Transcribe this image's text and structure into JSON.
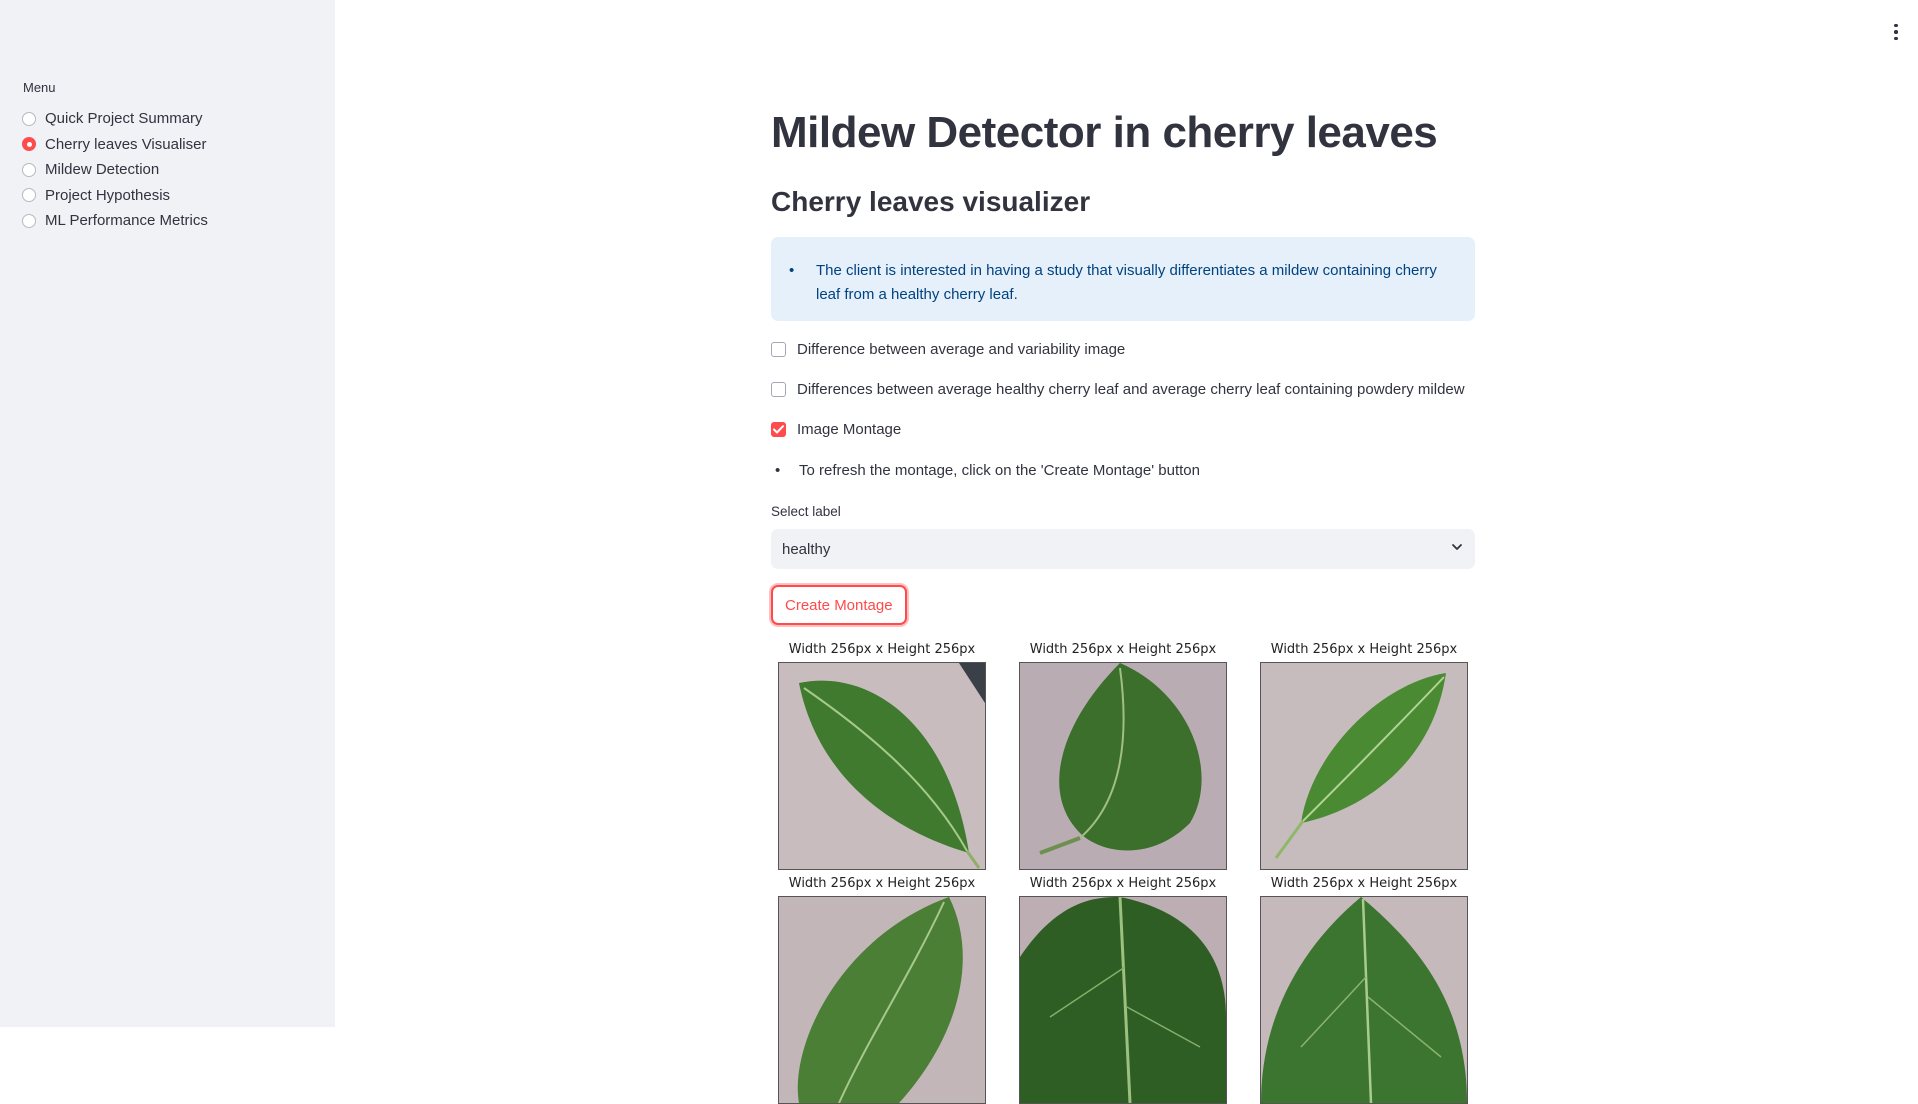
{
  "sidebar": {
    "menu_label": "Menu",
    "items": [
      {
        "label": "Quick Project Summary",
        "selected": false
      },
      {
        "label": "Cherry leaves Visualiser",
        "selected": true
      },
      {
        "label": "Mildew Detection",
        "selected": false
      },
      {
        "label": "Project Hypothesis",
        "selected": false
      },
      {
        "label": "ML Performance Metrics",
        "selected": false
      }
    ]
  },
  "header": {
    "menu_icon": "kebab-menu-icon"
  },
  "main": {
    "title": "Mildew Detector in cherry leaves",
    "subtitle": "Cherry leaves visualizer",
    "info_text": "The client is interested in having a study that visually differentiates a mildew containing cherry leaf from a healthy cherry leaf.",
    "checkboxes": [
      {
        "label": "Difference between average and variability image",
        "checked": false
      },
      {
        "label": "Differences between average healthy cherry leaf and average cherry leaf containing powdery mildew",
        "checked": false
      },
      {
        "label": "Image Montage",
        "checked": true
      }
    ],
    "refresh_note": "To refresh the montage, click on the 'Create Montage' button",
    "select_label": "Select label",
    "select_value": "healthy",
    "create_button": "Create Montage",
    "montage": {
      "captions": [
        "Width 256px x Height 256px",
        "Width 256px x Height 256px",
        "Width 256px x Height 256px",
        "Width 256px x Height 256px",
        "Width 256px x Height 256px",
        "Width 256px x Height 256px"
      ]
    }
  },
  "colors": {
    "accent": "#ff4b4b",
    "sidebar_bg": "#f0f2f6",
    "info_bg": "#e6f0fb",
    "info_text": "#004280",
    "text": "#31333f"
  }
}
